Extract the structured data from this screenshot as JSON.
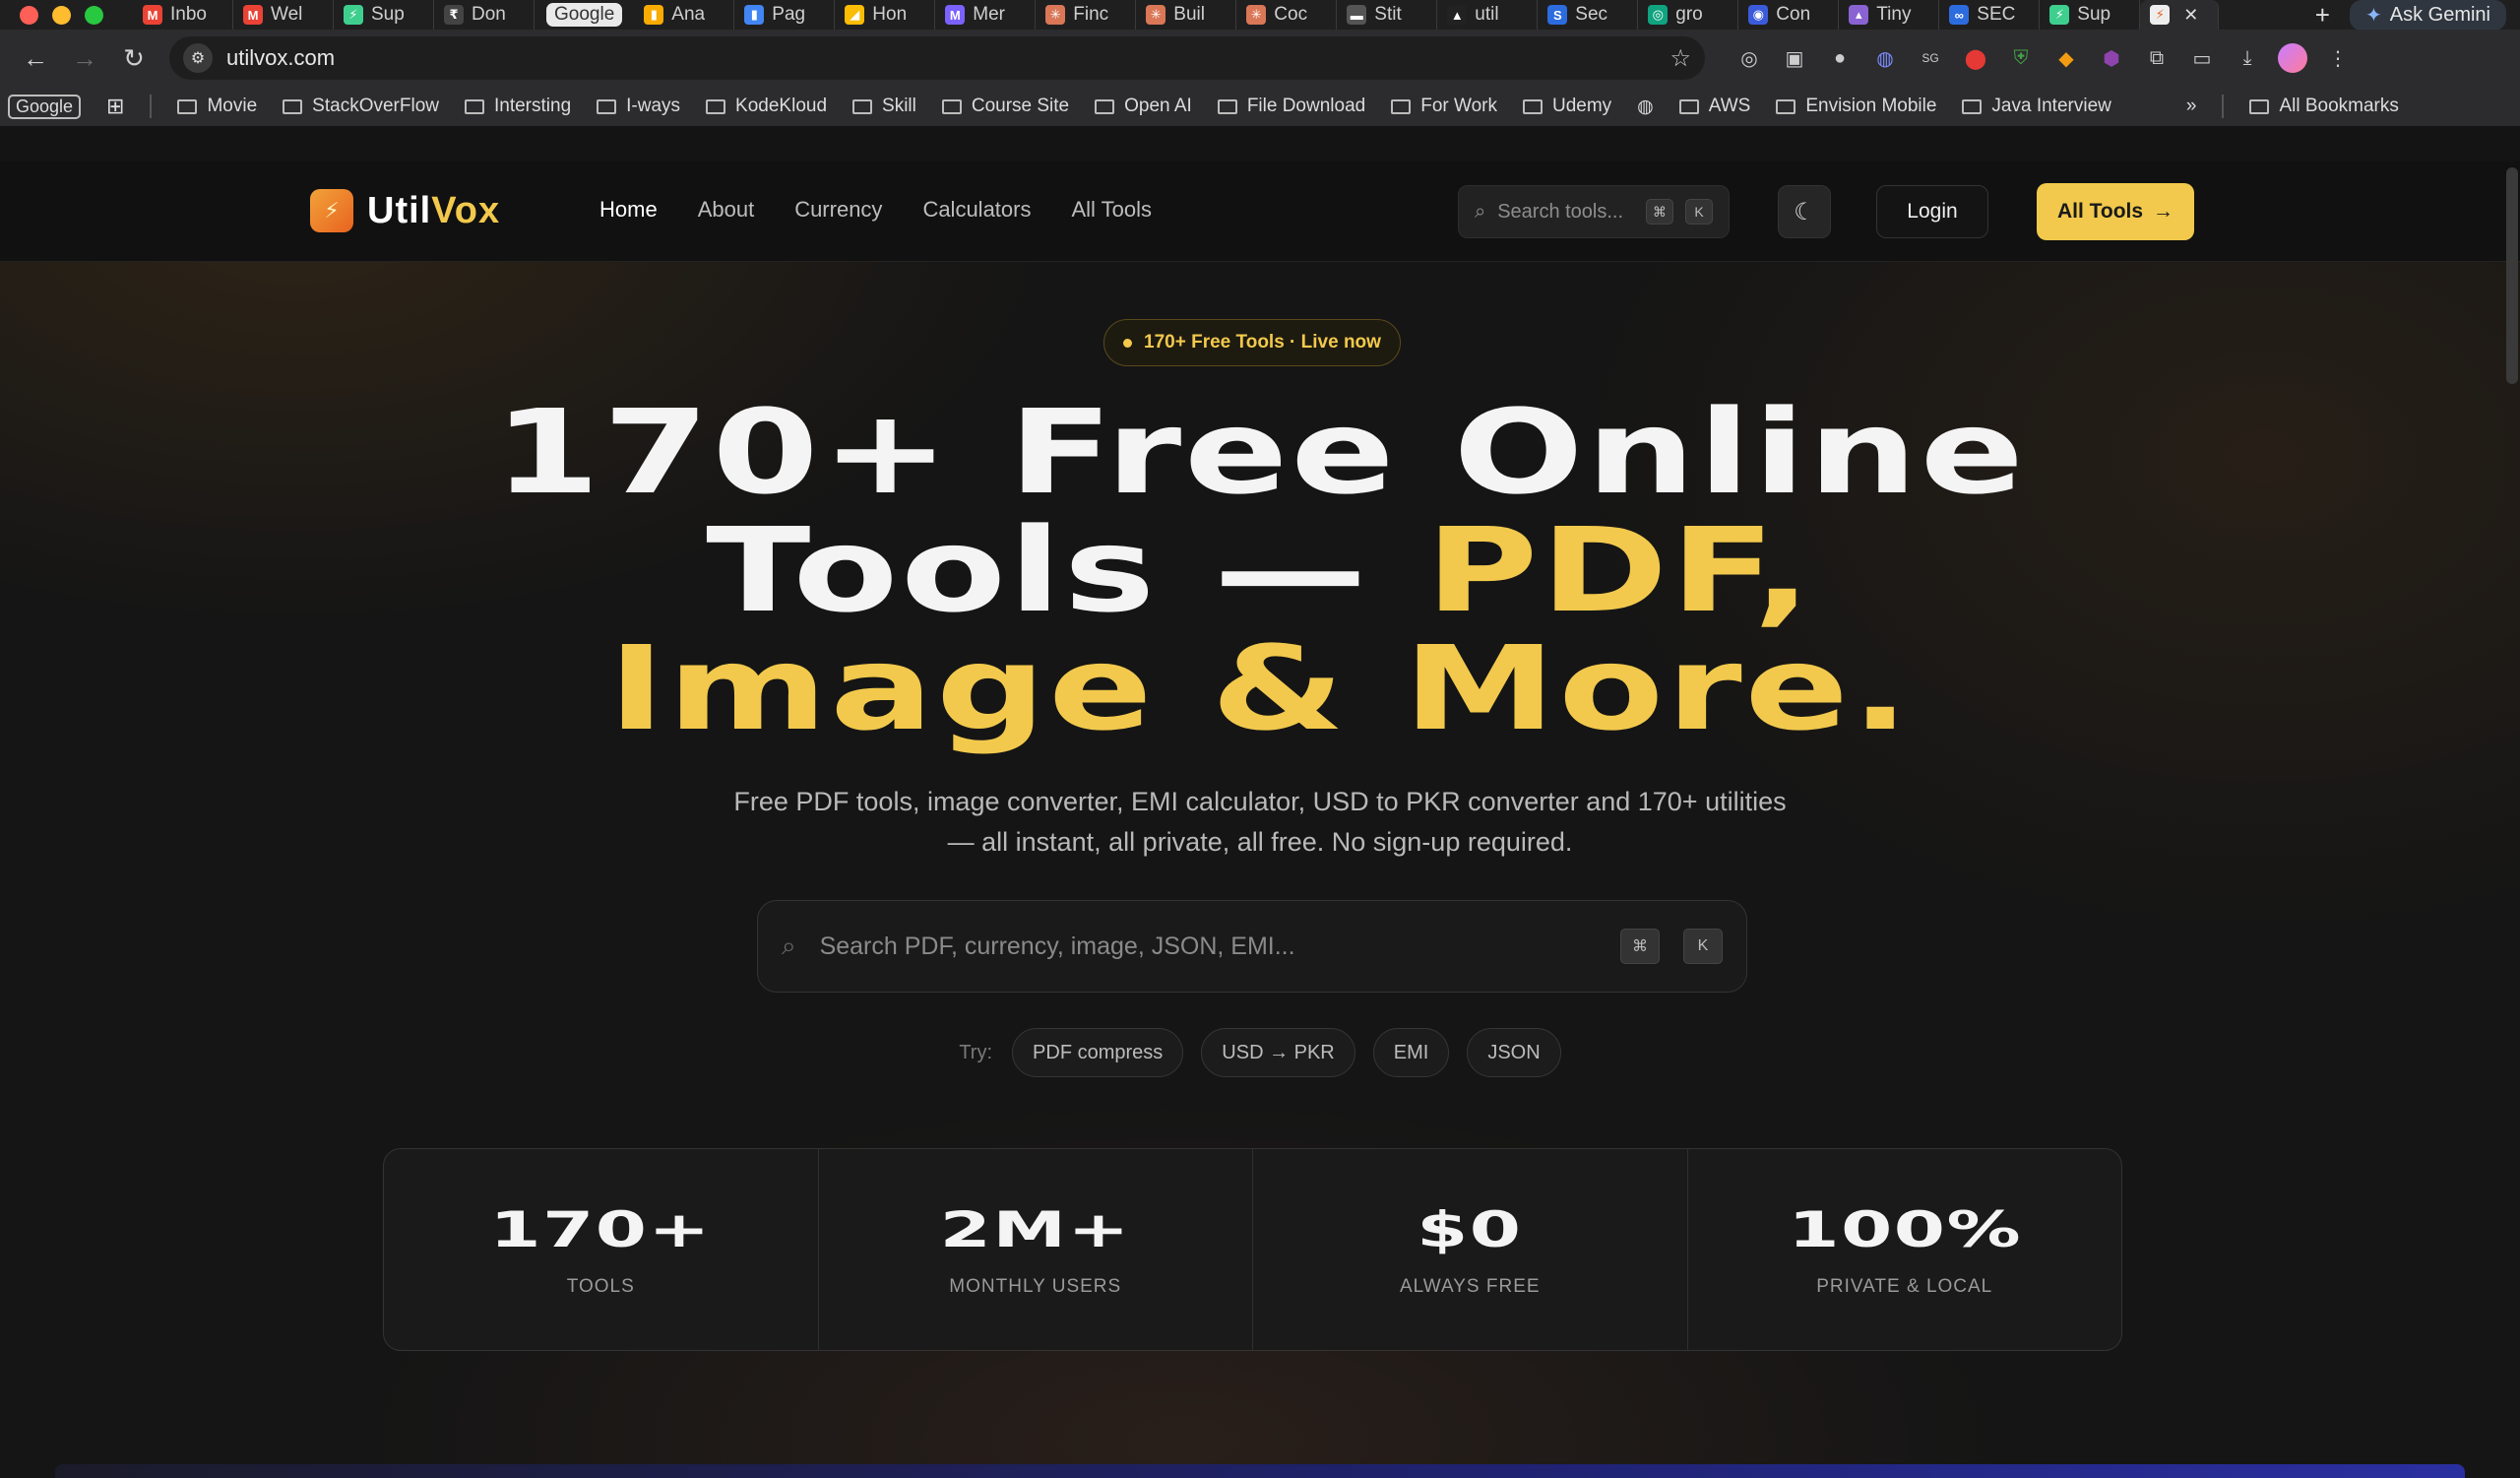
{
  "browser": {
    "tabs": [
      {
        "label": "Inbo",
        "icon": "gmail-icon",
        "color": "#ea4335",
        "glyph": "M"
      },
      {
        "label": "Wel",
        "icon": "gmail-icon",
        "color": "#ea4335",
        "glyph": "M"
      },
      {
        "label": "Sup",
        "icon": "bolt-icon",
        "color": "#3ecf8e",
        "glyph": "⚡"
      },
      {
        "label": "Don",
        "icon": "rupee-icon",
        "color": "#444444",
        "glyph": "₹"
      },
      {
        "label": "Ana",
        "icon": "analytics-icon",
        "color": "#f9ab00",
        "glyph": "▮"
      },
      {
        "label": "Pag",
        "icon": "pagespeed-icon",
        "color": "#4285f4",
        "glyph": "▮"
      },
      {
        "label": "Hon",
        "icon": "ads-icon",
        "color": "#fbbc04",
        "glyph": "◢"
      },
      {
        "label": "Mer",
        "icon": "merchant-icon",
        "color": "#7b61ff",
        "glyph": "M"
      },
      {
        "label": "Finc",
        "icon": "claude-icon",
        "color": "#d97757",
        "glyph": "✳"
      },
      {
        "label": "Buil",
        "icon": "claude-icon",
        "color": "#d97757",
        "glyph": "✳"
      },
      {
        "label": "Coc",
        "icon": "claude-icon",
        "color": "#d97757",
        "glyph": "✳"
      },
      {
        "label": "Stit",
        "icon": "stitch-icon",
        "color": "#555555",
        "glyph": "▬"
      },
      {
        "label": "util",
        "icon": "vercel-icon",
        "color": "#222222",
        "glyph": "▲"
      },
      {
        "label": "Sec",
        "icon": "s-icon",
        "color": "#2d6cdf",
        "glyph": "S"
      },
      {
        "label": "gro",
        "icon": "openai-icon",
        "color": "#10a37f",
        "glyph": "◎"
      },
      {
        "label": "Con",
        "icon": "circle-icon",
        "color": "#3b5bdb",
        "glyph": "◉"
      },
      {
        "label": "Tiny",
        "icon": "tiny-icon",
        "color": "#8a63d2",
        "glyph": "▴"
      },
      {
        "label": "SEC",
        "icon": "link-icon",
        "color": "#2d6cdf",
        "glyph": "∞"
      },
      {
        "label": "Sup",
        "icon": "bolt-icon",
        "color": "#3ecf8e",
        "glyph": "⚡"
      }
    ],
    "pill_tab": "Google",
    "pill_after_index": 3,
    "ask_gemini": "Ask Gemini",
    "url": "utilvox.com",
    "bookmarks": [
      "Movie",
      "StackOverFlow",
      "Intersting",
      "I-ways",
      "KodeKloud",
      "Skill",
      "Course Site",
      "Open AI",
      "File Download",
      "For Work",
      "Udemy"
    ],
    "bookmarks_more": [
      "AWS",
      "Envision Mobile",
      "Java Interview"
    ],
    "google_bookmark": "Google",
    "all_bookmarks": "All Bookmarks"
  },
  "site": {
    "logo_a": "Util",
    "logo_b": "Vox",
    "menu": [
      "Home",
      "About",
      "Currency",
      "Calculators",
      "All Tools"
    ],
    "nav_search_placeholder": "Search tools...",
    "kbd_cmd": "⌘",
    "kbd_k": "K",
    "login": "Login",
    "all_tools_btn": "All Tools",
    "badge": "170+ Free Tools · Live now",
    "hero_line1": "170+ Free Online",
    "hero_line2_white": "Tools — ",
    "hero_line2_yellow": "PDF,",
    "hero_line3": "Image & More.",
    "subtitle": "Free PDF tools, image converter, EMI calculator, USD to PKR converter and 170+ utilities — all instant, all private, all free. No sign-up required.",
    "search_placeholder": "Search PDF, currency, image, JSON, EMI...",
    "try_label": "Try:",
    "try_chips": [
      "PDF compress",
      "USD → PKR",
      "EMI",
      "JSON"
    ],
    "stats": [
      {
        "num": "170+",
        "label": "TOOLS"
      },
      {
        "num": "2M+",
        "label": "MONTHLY USERS"
      },
      {
        "num": "$0",
        "label": "ALWAYS FREE"
      },
      {
        "num": "100%",
        "label": "PRIVATE & LOCAL"
      }
    ],
    "accent": "#f2c94c"
  }
}
